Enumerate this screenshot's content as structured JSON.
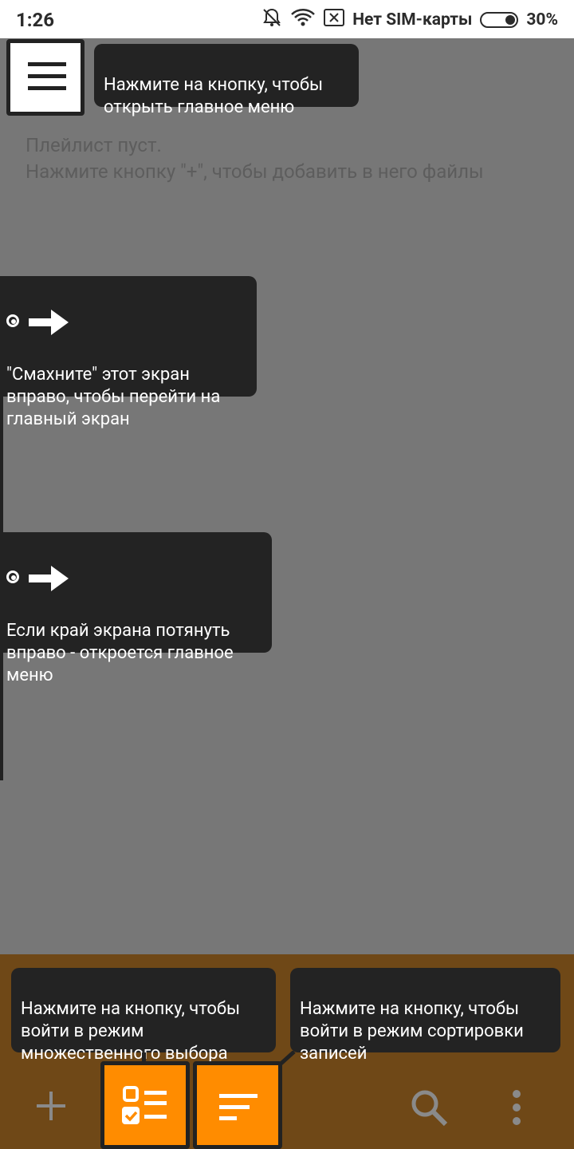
{
  "status_bar": {
    "time": "1:26",
    "carrier": "Нет SIM-карты",
    "battery": "30%"
  },
  "playlist": {
    "empty_message": "Плейлист пуст.\nНажмите кнопку \"+\", чтобы добавить в него файлы"
  },
  "tips": {
    "menu": "Нажмите на кнопку, чтобы\nоткрыть главное меню",
    "swipe": "\"Смахните\" этот экран\nвправо, чтобы перейти на\nглавный экран",
    "edge": "Если край экрана потянуть\nвправо - откроется главное\nменю",
    "multiselect": "Нажмите на кнопку, чтобы\nвойти в режим\nмножественного выбора",
    "sort": "Нажмите на кнопку, чтобы\nвойти в режим сортировки\nзаписей"
  },
  "icons": {
    "menu": "hamburger-icon",
    "add": "plus-icon",
    "multiselect": "checklist-icon",
    "sort": "sort-icon",
    "search": "search-icon",
    "more": "more-vert-icon"
  },
  "colors": {
    "overlay": "#777777",
    "bottom_bar": "#6f4817",
    "accent": "#ff8c00",
    "tooltip": "#232323"
  }
}
